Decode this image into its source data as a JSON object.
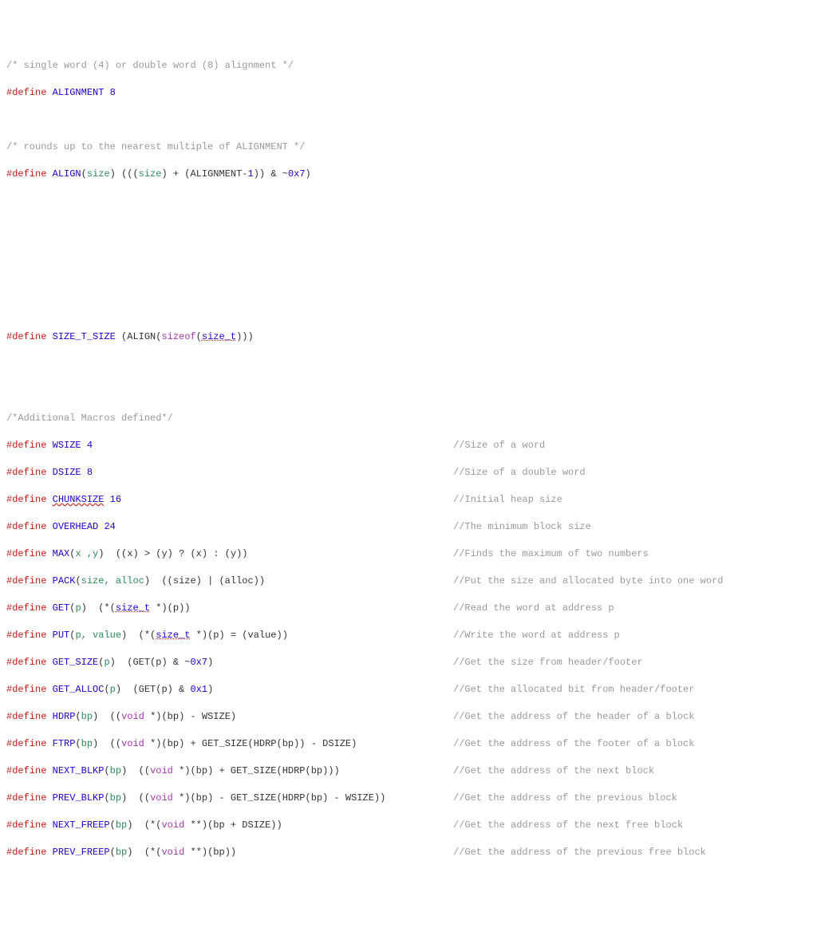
{
  "c1": "/* single word (4) or double word (8) alignment */",
  "d1n": "ALIGNMENT",
  "d1v": "8",
  "c2": "/* rounds up to the nearest multiple of ALIGNMENT */",
  "d2n": "ALIGN",
  "d2a": "size",
  "d2b": "(((",
  "d2c": ") + (ALIGNMENT-",
  "d2d": "1",
  "d2e": ")) & ~",
  "d2f": "0x7",
  "d2g": ")",
  "d3n": "SIZE_T_SIZE",
  "d3b": " (ALIGN(",
  "d3kw": "sizeof",
  "d3c": "(",
  "d3t": "size_t",
  "d3d": ")))",
  "c3": "/*Additional Macros defined*/",
  "m1n": "WSIZE",
  "m1v": "4",
  "m1c": "//Size of a word",
  "m2n": "DSIZE",
  "m2v": "8",
  "m2c": "//Size of a double word",
  "m3n": "CHUNKSIZE",
  "m3v": "16",
  "m3c": "//Initial heap size",
  "m4n": "OVERHEAD",
  "m4v": "24",
  "m4c": "//The minimum block size",
  "m5n": "MAX",
  "m5a": "x ,y",
  "m5b": "  ((x) > (y) ? (x) : (y))",
  "m5c": "//Finds the maximum of two numbers",
  "m6n": "PACK",
  "m6a": "size, alloc",
  "m6b": "  ((size) | (alloc))",
  "m6c": "//Put the size and allocated byte into one word",
  "m7n": "GET",
  "m7a": "p",
  "m7b": "  (*(",
  "m7t": "size_t",
  "m7b2": " *)(p))",
  "m7c": "//Read the word at address p",
  "m8n": "PUT",
  "m8a": "p, value",
  "m8b": "  (*(",
  "m8t": "size_t",
  "m8b2": " *)(p) = (value))",
  "m8c": "//Write the word at address p",
  "m9n": "GET_SIZE",
  "m9a": "p",
  "m9b": "  (GET(p) & ~",
  "m9v": "0x7",
  "m9b2": ")",
  "m9c": "//Get the size from header/footer",
  "m10n": "GET_ALLOC",
  "m10a": "p",
  "m10b": "  (GET(p) & ",
  "m10v": "0x1",
  "m10b2": ")",
  "m10c": "//Get the allocated bit from header/footer",
  "m11n": "HDRP",
  "m11a": "bp",
  "m11b": "  ((",
  "m11kw": "void",
  "m11b2": " *)(bp) - WSIZE)",
  "m11c": "//Get the address of the header of a block",
  "m12n": "FTRP",
  "m12a": "bp",
  "m12b": "  ((",
  "m12kw": "void",
  "m12b2": " *)(bp) + GET_SIZE(HDRP(bp)) - DSIZE)",
  "m12c": "//Get the address of the footer of a block",
  "m13n": "NEXT_BLKP",
  "m13a": "bp",
  "m13b": "  ((",
  "m13kw": "void",
  "m13b2": " *)(bp) + GET_SIZE(HDRP(bp)))",
  "m13c": "//Get the address of the next block",
  "m14n": "PREV_BLKP",
  "m14a": "bp",
  "m14b": "  ((",
  "m14kw": "void",
  "m14b2": " *)(bp) - GET_SIZE(HDRP(bp) - WSIZE))",
  "m14c": "//Get the address of the previous block",
  "m15n": "NEXT_FREEP",
  "m15a": "bp",
  "m15b": "  (*(",
  "m15kw": "void",
  "m15b2": " **)(bp + DSIZE))",
  "m15c": "//Get the address of the next free block",
  "m16n": "PREV_FREEP",
  "m16a": "bp",
  "m16b": "  (*(",
  "m16kw": "void",
  "m16b2": " **)(bp))",
  "m16c": "//Get the address of the previous free block",
  "hash": "#",
  "define": "define ",
  "sp": " ",
  "lp": "(",
  "rp": ")"
}
